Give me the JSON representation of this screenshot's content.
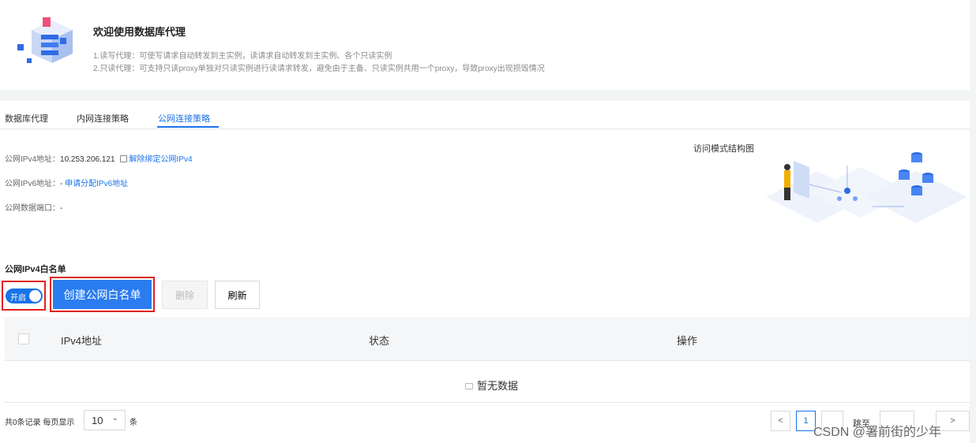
{
  "banner": {
    "title": "欢迎使用数据库代理",
    "line1": "1.读写代理：可使写请求自动转发到主实例，读请求自动转发到主实例、各个只读实例",
    "line2": "2.只读代理：可支持只读proxy单独对只读实例进行读请求转发，避免由于主备、只读实例共用一个proxy，导致proxy出现损毁情况"
  },
  "tabs": [
    {
      "label": "数据库代理",
      "active": false
    },
    {
      "label": "内网连接策略",
      "active": false
    },
    {
      "label": "公网连接策略",
      "active": true
    }
  ],
  "info": {
    "ipv4_label": "公网IPv4地址：",
    "ipv4_value": "10.253.206.121",
    "ipv4_action": "解除绑定公网IPv4",
    "ipv6_label": "公网IPv6地址：",
    "ipv6_value": "- ",
    "ipv6_action": "申请分配IPv6地址",
    "port_label": "公网数据端口：",
    "port_value": "-"
  },
  "diagram": {
    "title": "访问模式结构图"
  },
  "whitelist": {
    "section_title": "公网IPv4白名单",
    "toggle_label": "开启",
    "create_label": "创建公网白名单",
    "delete_label": "删除",
    "refresh_label": "刷新"
  },
  "table": {
    "columns": [
      "IPv4地址",
      "状态",
      "操作"
    ],
    "rows": [],
    "empty_text": "暂无数据"
  },
  "pagination": {
    "summary": "共0条记录 每页显示",
    "page_size": "10",
    "unit": "条",
    "prev": "<",
    "current_page": "1",
    "goto_text": "跳至",
    "next": ">"
  },
  "watermark": "CSDN @署前街的少年",
  "colors": {
    "primary": "#1a73e8",
    "highlight_border": "#e02020",
    "header_bg": "#f5f6f8"
  }
}
